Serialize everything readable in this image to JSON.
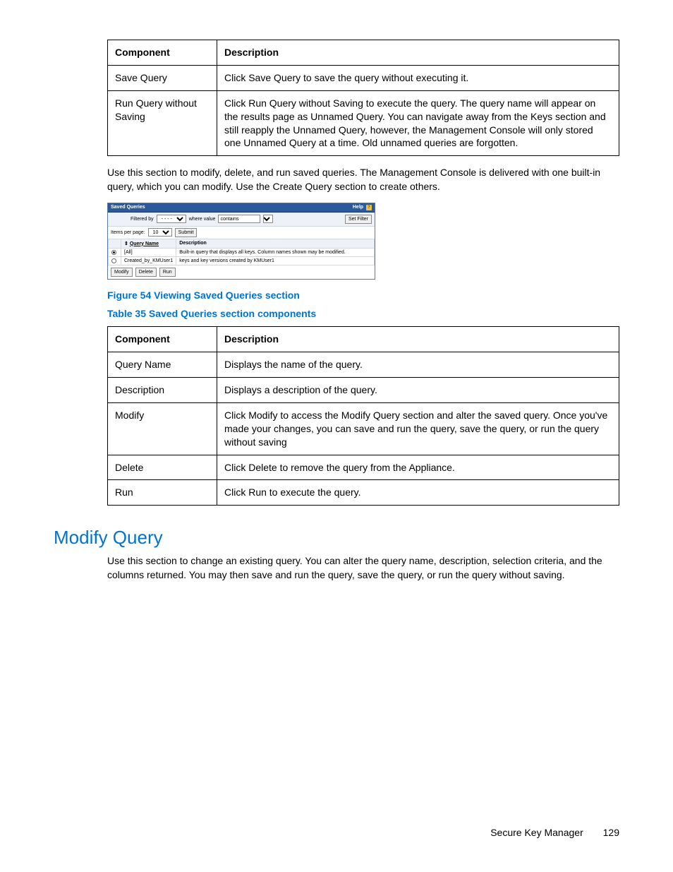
{
  "table1": {
    "head": {
      "c1": "Component",
      "c2": "Description"
    },
    "rows": [
      {
        "c1": "Save Query",
        "c2": "Click Save Query to save the query without executing it."
      },
      {
        "c1": "Run Query without Saving",
        "c2": "Click Run Query without Saving to execute the query. The query name will appear on the results page as Unnamed Query. You can navigate away from the Keys section and still reapply the Unnamed Query, however, the Management Console will only stored one Unnamed Query at a time. Old unnamed queries are forgotten."
      }
    ]
  },
  "para1": "Use this section to modify, delete, and run saved queries. The Management Console is delivered with one built-in query, which you can modify. Use the Create Query section to create others.",
  "shot": {
    "title": "Saved Queries",
    "help": "Help",
    "filtered_by": "Filtered by",
    "filter_sel": "- - - -",
    "where_value": "where value",
    "contains": "contains",
    "set_filter": "Set Filter",
    "items_per_page": "Items per page:",
    "items_val": "10",
    "submit": "Submit",
    "col_qn": "Query Name",
    "col_desc": "Description",
    "row1_name": "[All]",
    "row1_desc": "Built-in query that displays all keys. Column names shown may be modified.",
    "row2_name": "Created_by_KMUser1",
    "row2_desc": "keys and key versions created by KMUser1",
    "btn_modify": "Modify",
    "btn_delete": "Delete",
    "btn_run": "Run"
  },
  "fig_caption": "Figure 54 Viewing Saved Queries section",
  "tbl_caption": "Table 35 Saved Queries section components",
  "table2": {
    "head": {
      "c1": "Component",
      "c2": "Description"
    },
    "rows": [
      {
        "c1": "Query Name",
        "c2": "Displays the name of the query."
      },
      {
        "c1": "Description",
        "c2": "Displays a description of the query."
      },
      {
        "c1": "Modify",
        "c2": "Click Modify to access the Modify Query section and alter the saved query. Once you've made your changes, you can save and run the query, save the query, or run the query without saving"
      },
      {
        "c1": "Delete",
        "c2": "Click Delete to remove the query from the Appliance."
      },
      {
        "c1": "Run",
        "c2": "Click Run to execute the query."
      }
    ]
  },
  "heading": "Modify Query",
  "para2": "Use this section to change an existing query. You can alter the query name, description, selection criteria, and the columns returned. You may then save and run the query, save the query, or run the query without saving.",
  "footer": {
    "doc": "Secure Key Manager",
    "page": "129"
  }
}
